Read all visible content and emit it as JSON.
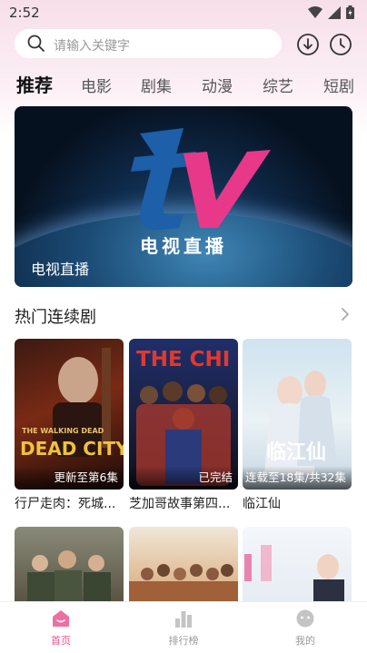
{
  "status": {
    "time": "2:52"
  },
  "search": {
    "placeholder": "请输入关键字"
  },
  "tabs": [
    {
      "label": "推荐"
    },
    {
      "label": "电影"
    },
    {
      "label": "剧集"
    },
    {
      "label": "动漫"
    },
    {
      "label": "综艺"
    },
    {
      "label": "短剧"
    }
  ],
  "banner": {
    "label": "电视直播",
    "logo_text": "tv",
    "logo_caption": "电视直播"
  },
  "section": {
    "title": "热门连续剧"
  },
  "cards": [
    {
      "title": "行尸走肉：死城...",
      "badge": "更新至第6集",
      "poster_title": "DEAD CITY",
      "poster_sub": "THE WALKING DEAD"
    },
    {
      "title": "芝加哥故事第四...",
      "badge": "已完结",
      "poster_title": "THE CHI"
    },
    {
      "title": "临江仙",
      "badge": "连载至18集/共32集",
      "poster_title": "临江仙"
    }
  ],
  "bottom_nav": [
    {
      "label": "首页"
    },
    {
      "label": "排行榜"
    },
    {
      "label": "我的"
    }
  ],
  "colors": {
    "accent": "#e8558f",
    "tv_blue": "#1d5fa8",
    "tv_pink": "#e8388a"
  }
}
